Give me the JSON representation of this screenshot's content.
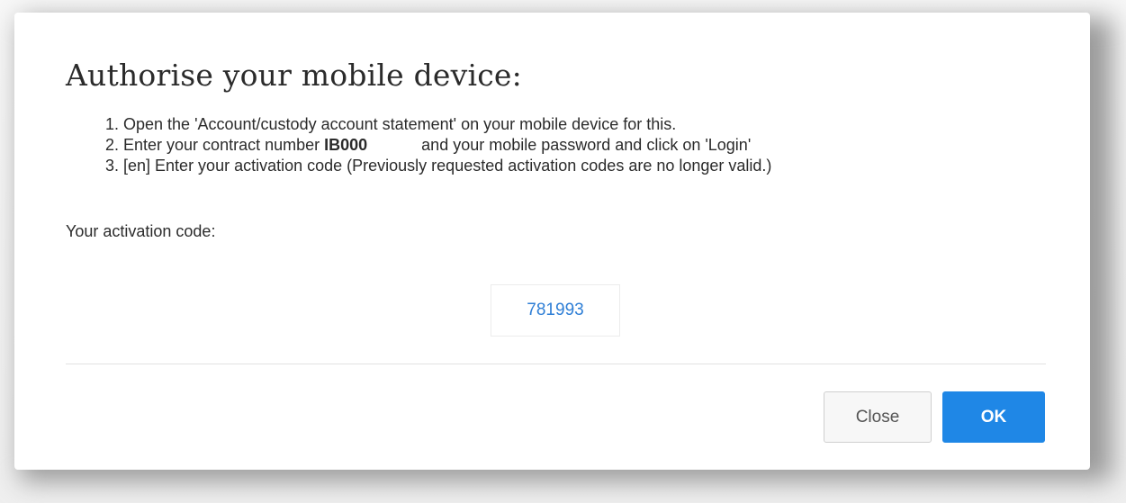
{
  "dialog": {
    "title": "Authorise your mobile device:",
    "steps": {
      "step1": "1. Open the 'Account/custody account statement' on your mobile device for this.",
      "step2_prefix": "2. Enter your contract number ",
      "step2_contract": "IB000",
      "step2_suffix": "and your mobile password and click on 'Login'",
      "step3": "3. [en] Enter your activation code (Previously requested activation codes are no longer valid.)"
    },
    "code_label": "Your activation code:",
    "activation_code": "781993",
    "buttons": {
      "close": "Close",
      "ok": "OK"
    }
  },
  "colors": {
    "accent": "#1f87e6",
    "code_text": "#2f7fd6",
    "text": "#2b2b2b"
  }
}
